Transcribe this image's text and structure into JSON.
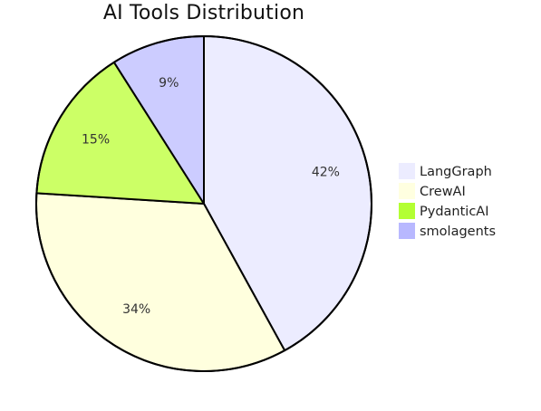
{
  "chart_data": {
    "type": "pie",
    "title": "AI Tools Distribution",
    "categories": [
      "LangGraph",
      "CrewAI",
      "PydanticAI",
      "smolagents"
    ],
    "values": [
      42,
      34,
      15,
      9
    ],
    "labels": [
      "42%",
      "34%",
      "15%",
      "9%"
    ],
    "colors": [
      "#ECECFF",
      "#FFFFDE",
      "#CCFF66",
      "#CCCCFF"
    ],
    "legend_colors": [
      "#ECECFF",
      "#FFFFE0",
      "#B3FF33",
      "#B8B8FF"
    ],
    "legend_position": "right",
    "start_angle_deg": 0,
    "direction": "clockwise"
  }
}
